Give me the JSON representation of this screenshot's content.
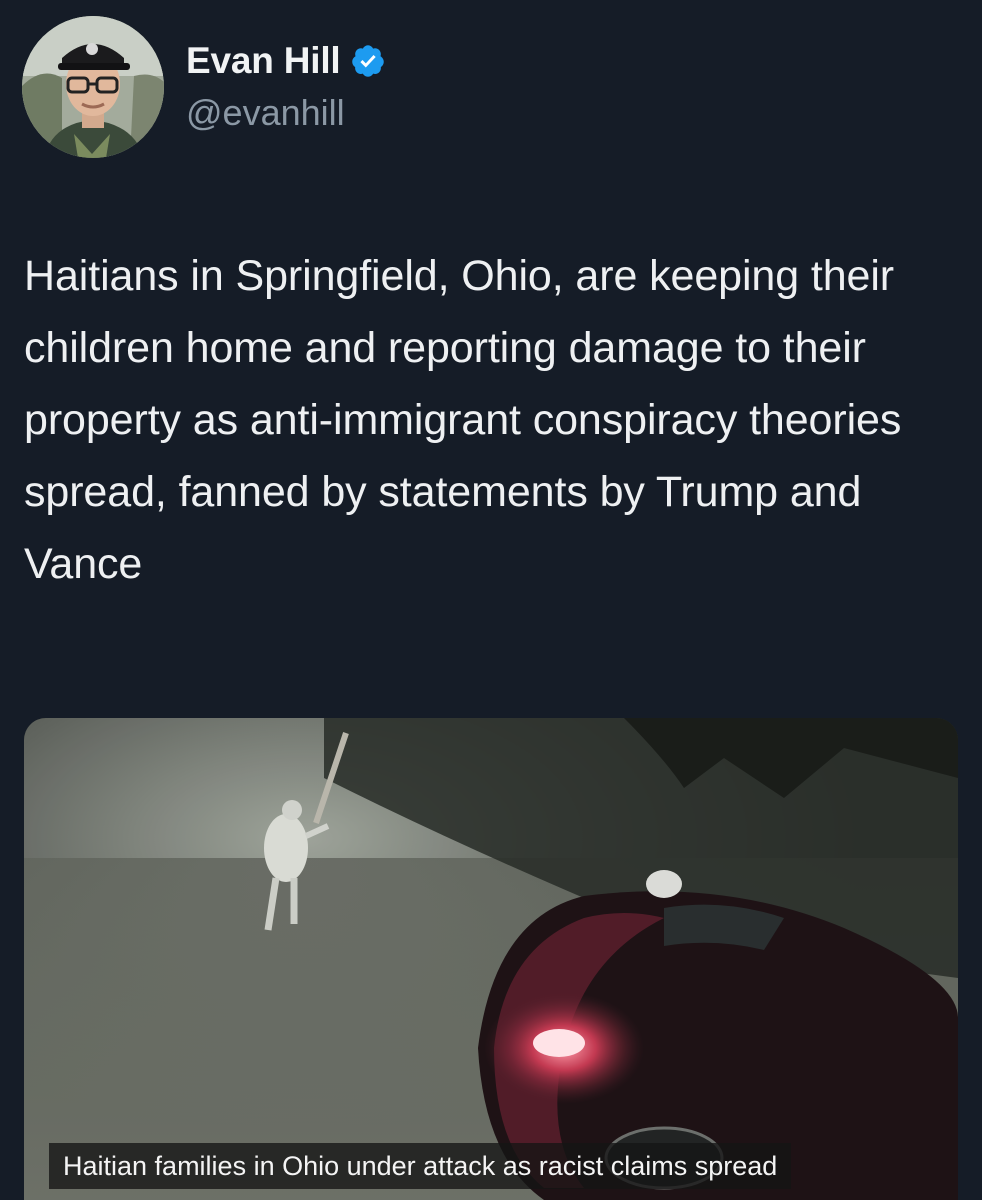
{
  "author": {
    "display_name": "Evan Hill",
    "handle": "@evanhill",
    "verified": true,
    "verified_color": "#1d9bf0",
    "avatar_icon": "profile-photo"
  },
  "tweet": {
    "text": "Haitians in Springfield, Ohio, are keeping their children home and reporting damage to their property as anti-immigrant conspiracy theories spread, fanned by statements by Trump and Vance"
  },
  "media": {
    "type": "video-still",
    "caption": "Haitian families in Ohio under attack as racist claims spread"
  },
  "theme": {
    "background": "#151c27",
    "text": "#eef0f2",
    "secondary_text": "#8b98a5"
  }
}
